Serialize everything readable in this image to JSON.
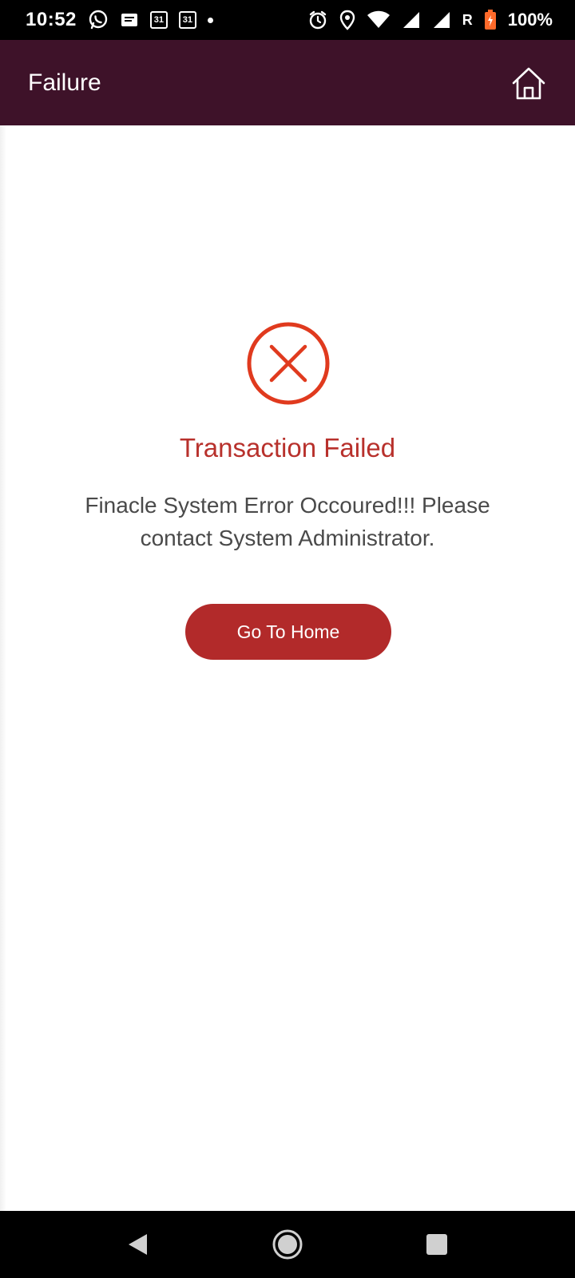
{
  "status_bar": {
    "time": "10:52",
    "calendar_day_1": "31",
    "calendar_day_2": "31",
    "roaming": "R",
    "battery": "100%"
  },
  "app_bar": {
    "title": "Failure",
    "home_icon": "home-icon"
  },
  "result": {
    "icon": "error-circle-icon",
    "title": "Transaction Failed",
    "message": "Finacle System Error Occoured!!! Please contact System Administrator.",
    "button_label": "Go To Home"
  },
  "colors": {
    "app_bar": "#3e1229",
    "error": "#e03a1e",
    "title": "#b8312c",
    "button": "#b22a2a"
  },
  "nav_bar": {
    "back_icon": "back-triangle-icon",
    "home_icon": "home-circle-icon",
    "recents_icon": "recents-square-icon"
  }
}
